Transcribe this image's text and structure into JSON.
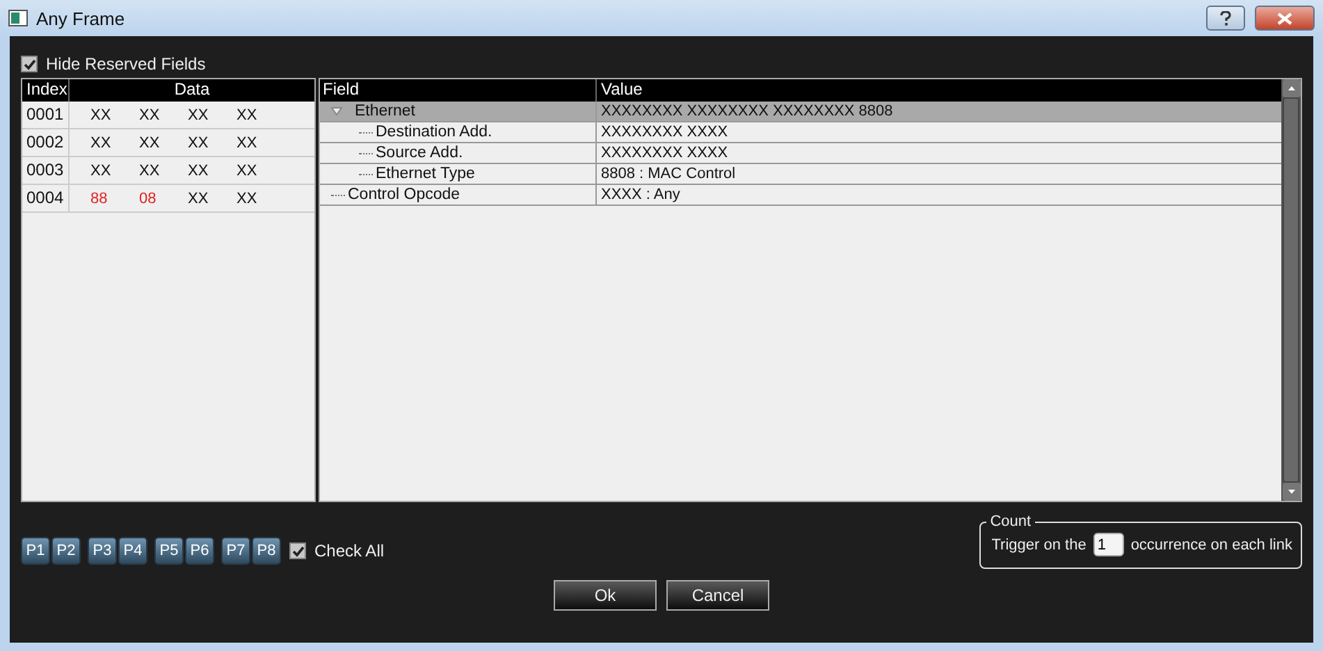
{
  "window": {
    "title": "Any Frame"
  },
  "hide_reserved_fields": {
    "label": "Hide Reserved Fields",
    "checked": true
  },
  "data_table": {
    "columns": [
      "Index",
      "Data"
    ],
    "rows": [
      {
        "index": "0001",
        "data": {
          "bytes": [
            {
              "text": "XX",
              "changed": false
            },
            {
              "text": "XX",
              "changed": false
            },
            {
              "text": "XX",
              "changed": false
            },
            {
              "text": "XX",
              "changed": false
            }
          ]
        }
      },
      {
        "index": "0002",
        "data": {
          "bytes": [
            {
              "text": "XX",
              "changed": false
            },
            {
              "text": "XX",
              "changed": false
            },
            {
              "text": "XX",
              "changed": false
            },
            {
              "text": "XX",
              "changed": false
            }
          ]
        }
      },
      {
        "index": "0003",
        "data": {
          "bytes": [
            {
              "text": "XX",
              "changed": false
            },
            {
              "text": "XX",
              "changed": false
            },
            {
              "text": "XX",
              "changed": false
            },
            {
              "text": "XX",
              "changed": false
            }
          ]
        }
      },
      {
        "index": "0004",
        "data": {
          "bytes": [
            {
              "text": "88",
              "changed": true
            },
            {
              "text": "08",
              "changed": true
            },
            {
              "text": "XX",
              "changed": false
            },
            {
              "text": "XX",
              "changed": false
            }
          ]
        }
      }
    ]
  },
  "field_tree": {
    "columns": [
      "Field",
      "Value"
    ],
    "items": [
      {
        "field": "Ethernet",
        "value": "XXXXXXXX XXXXXXXX XXXXXXXX 8808",
        "selected": true,
        "expanded": true,
        "children": [
          {
            "field": "Destination Add.",
            "value": "XXXXXXXX XXXX",
            "selected": false
          },
          {
            "field": "Source Add.",
            "value": "XXXXXXXX XXXX",
            "selected": false
          },
          {
            "field": "Ethernet Type",
            "value": "8808 : MAC Control",
            "selected": false
          }
        ]
      },
      {
        "field": "Control Opcode",
        "value": "XXXX : Any",
        "selected": false
      }
    ]
  },
  "port_buttons": [
    [
      "P1",
      "P2"
    ],
    [
      "P3",
      "P4"
    ],
    [
      "P5",
      "P6"
    ],
    [
      "P7",
      "P8"
    ]
  ],
  "check_all": {
    "label": "Check All",
    "checked": true
  },
  "count": {
    "title": "Count",
    "prefix": "Trigger on the",
    "value": "1",
    "suffix": "occurrence on each link"
  },
  "buttons": [
    "Ok",
    "Cancel"
  ]
}
